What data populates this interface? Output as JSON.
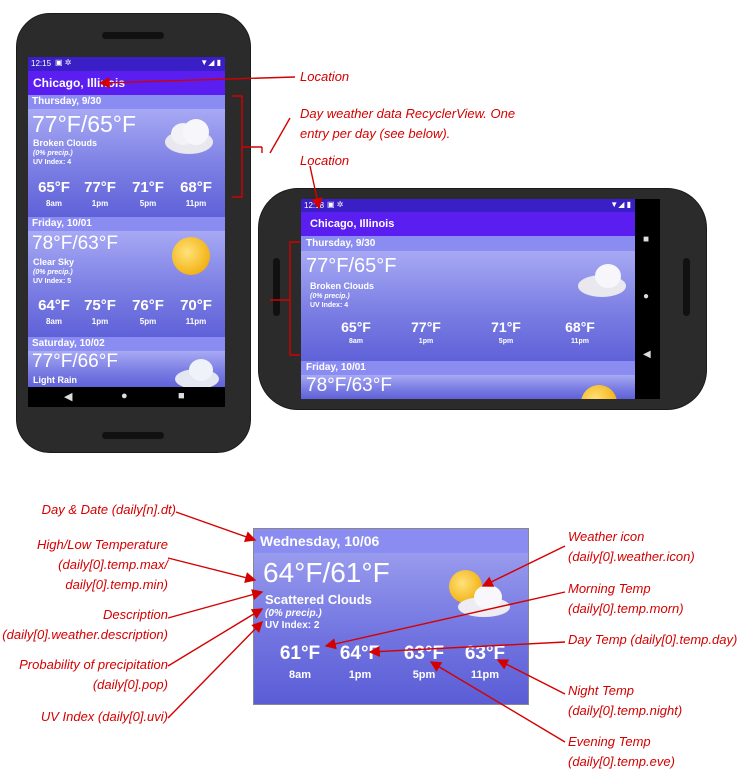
{
  "phone_portrait": {
    "status_time": "12:15",
    "status_icons": "▼◢ ▮",
    "location": "Chicago, Illinois",
    "days": [
      {
        "header": "Thursday, 9/30",
        "hilo": "77°F/65°F",
        "desc": "Broken Clouds",
        "pop": "(0% precip.)",
        "uvi": "UV Index: 4",
        "temps": [
          "65°F",
          "77°F",
          "71°F",
          "68°F"
        ],
        "times": [
          "8am",
          "1pm",
          "5pm",
          "11pm"
        ],
        "icon": "cloud-icon"
      },
      {
        "header": "Friday, 10/01",
        "hilo": "78°F/63°F",
        "desc": "Clear Sky",
        "pop": "(0% precip.)",
        "uvi": "UV Index: 5",
        "temps": [
          "64°F",
          "75°F",
          "76°F",
          "70°F"
        ],
        "times": [
          "8am",
          "1pm",
          "5pm",
          "11pm"
        ],
        "icon": "sun-icon"
      },
      {
        "header": "Saturday, 10/02",
        "hilo": "77°F/66°F",
        "desc": "Light Rain",
        "icon": "rain-cloud-icon"
      }
    ],
    "nav": [
      "◀",
      "●",
      "■"
    ]
  },
  "phone_landscape": {
    "status_time": "12:18",
    "status_icons": "▼◢ ▮",
    "location": "Chicago, Illinois",
    "days": [
      {
        "header": "Thursday, 9/30",
        "hilo": "77°F/65°F",
        "desc": "Broken Clouds",
        "pop": "(0% precip.)",
        "uvi": "UV Index: 4",
        "temps": [
          "65°F",
          "77°F",
          "71°F",
          "68°F"
        ],
        "times": [
          "8am",
          "1pm",
          "5pm",
          "11pm"
        ],
        "icon": "cloud-icon"
      },
      {
        "header": "Friday, 10/01",
        "hilo": "78°F/63°F",
        "icon": "sun-icon"
      }
    ],
    "nav": [
      "■",
      "●",
      "◀"
    ]
  },
  "detail": {
    "header": "Wednesday, 10/06",
    "hilo": "64°F/61°F",
    "desc": "Scattered Clouds",
    "pop": "(0% precip.)",
    "uvi": "UV Index: 2",
    "temps": [
      "61°F",
      "64°F",
      "63°F",
      "63°F"
    ],
    "times": [
      "8am",
      "1pm",
      "5pm",
      "11pm"
    ],
    "icon": "sun-behind-cloud-icon"
  },
  "annotations": {
    "location_top": "Location",
    "recycler": "Day weather data RecyclerView. One entry per day (see below).",
    "location_mid": "Location",
    "day_date": "Day & Date (daily[n].dt)",
    "hilo": "High/Low Temperature (daily[0].temp.max/ daily[0].temp.min)",
    "desc": "Description (daily[0].weather.description)",
    "pop": "Probability of precipitation (daily[0].pop)",
    "uvi": "UV Index (daily[0].uvi)",
    "weather_icon": "Weather icon (daily[0].weather.icon)",
    "morn": "Morning Temp (daily[0].temp.morn)",
    "day": "Day Temp (daily[0].temp.day)",
    "night": "Night Temp (daily[0].temp.night)",
    "eve": "Evening Temp (daily[0].temp.eve)"
  },
  "colors": {
    "annotation": "#d40000",
    "status": "#3a1fc7",
    "location_bar": "#5b1ef0",
    "day_header": "#8b8cf2"
  }
}
